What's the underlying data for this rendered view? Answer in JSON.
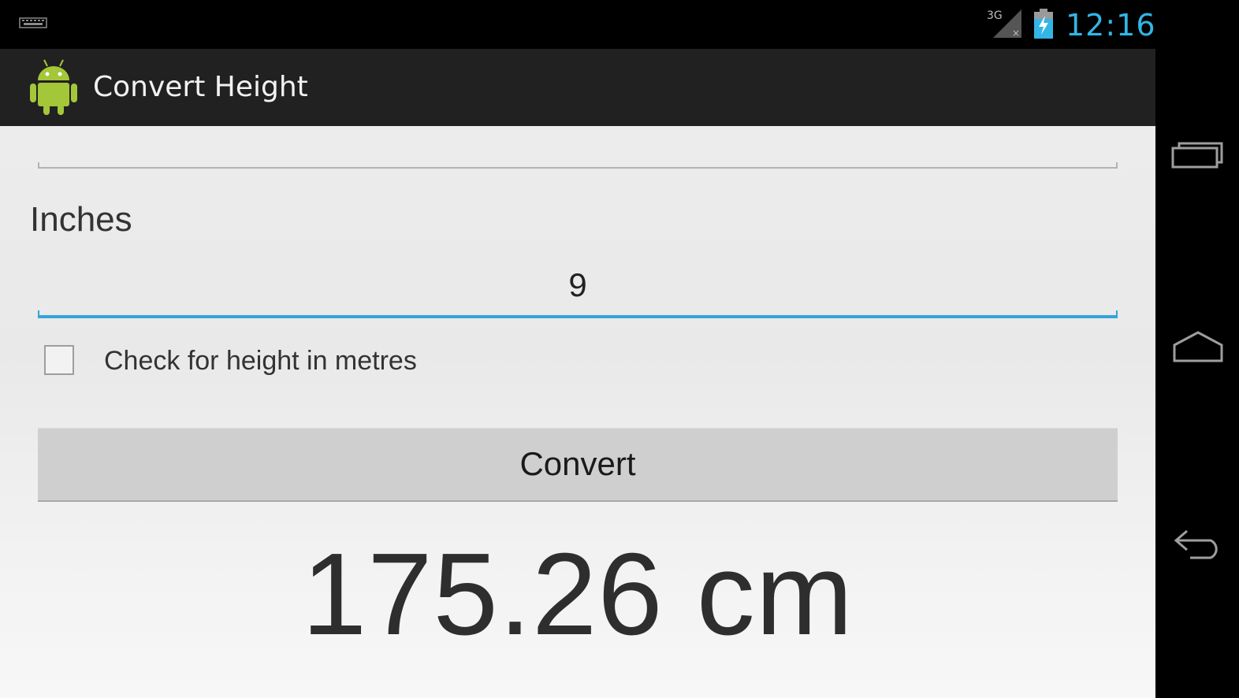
{
  "status_bar": {
    "time": "12:16",
    "network_type": "3G",
    "accent_color": "#33b5e5"
  },
  "action_bar": {
    "title": "Convert Height",
    "icon": "android-robot-icon"
  },
  "form": {
    "feet_field": {
      "value": ""
    },
    "inches_label": "Inches",
    "inches_field": {
      "value": "9"
    },
    "metres_checkbox": {
      "label": "Check for height in metres",
      "checked": false
    },
    "convert_button_label": "Convert"
  },
  "result": {
    "text": "175.26 cm"
  },
  "nav_bar": {
    "buttons": [
      "recent-apps-icon",
      "home-icon",
      "back-icon"
    ]
  },
  "colors": {
    "focus_underline": "#33a5d8",
    "action_bar_bg": "#212121",
    "android_green": "#a4c639"
  }
}
